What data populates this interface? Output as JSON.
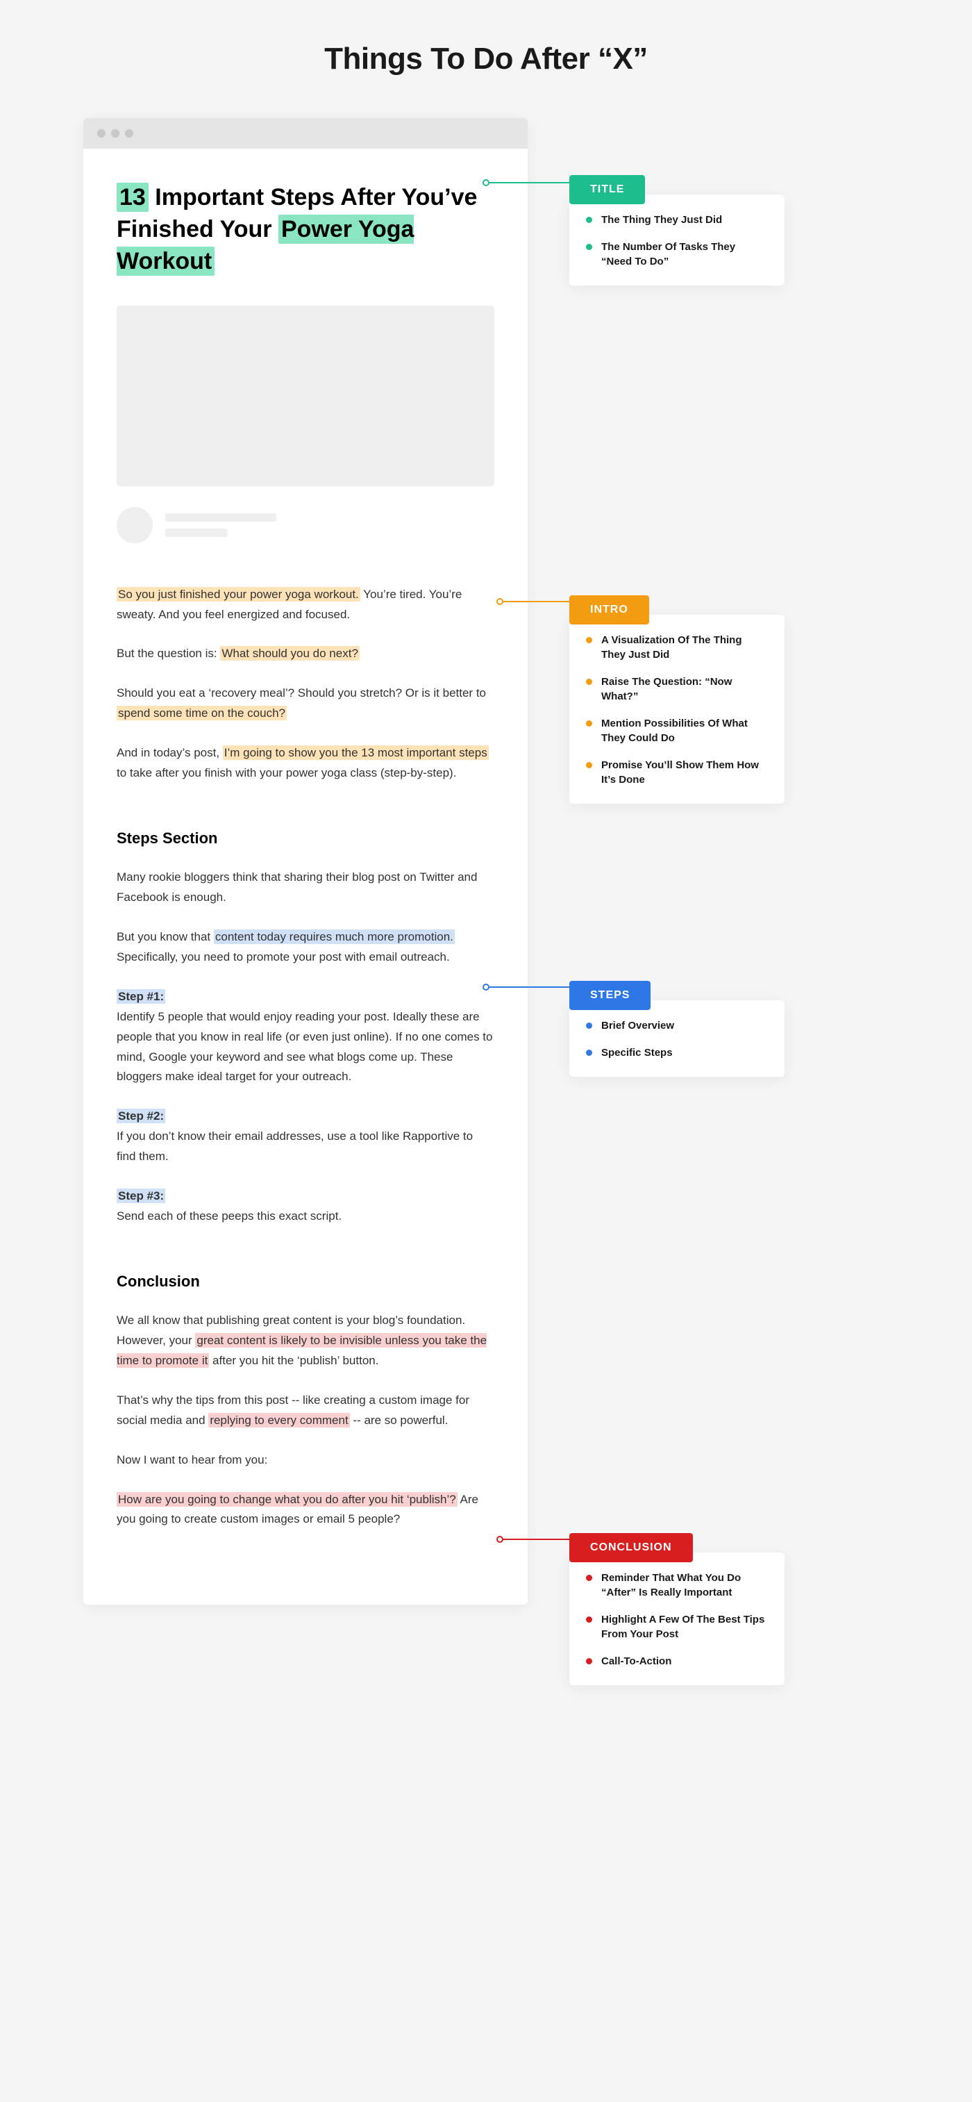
{
  "page_title": "Things To Do After “X”",
  "article": {
    "title_parts": {
      "num": "13",
      "mid": " Important Steps After You’ve Finished Your ",
      "topic": "Power Yoga Workout"
    },
    "intro": {
      "p1_hl": "So you just finished your power yoga workout.",
      "p1_rest": " You’re tired. You’re sweaty. And you feel energized and focused.",
      "p2_a": "But the question is: ",
      "p2_hl": "What should you do next?",
      "p3_a": "Should you eat a ‘recovery meal’? Should you stretch? Or is it better to ",
      "p3_hl": "spend some time on the couch?",
      "p4_a": "And in today’s post, ",
      "p4_hl": "I’m going to show you the 13 most important steps",
      "p4_b": " to take after you finish with your power yoga class (step-by-step)."
    },
    "steps": {
      "heading": "Steps Section",
      "p1": "Many rookie bloggers think that sharing their blog post on Twitter and Facebook is enough.",
      "p2_a": "But you know that ",
      "p2_hl": "content today requires much more promotion.",
      "p2_b": " Specifically, you need to promote your post with email outreach.",
      "s1_label": "Step #1:",
      "s1_body": "Identify 5 people that would enjoy reading your post. Ideally these are people that you know in real life (or even just online). If no one comes to mind, Google your keyword and see what blogs come up. These bloggers make ideal target for your outreach.",
      "s2_label": "Step #2:",
      "s2_body": "If you don’t know their email addresses, use a tool like Rapportive to find them.",
      "s3_label": "Step #3:",
      "s3_body": "Send each of these peeps this exact script."
    },
    "conclusion": {
      "heading": "Conclusion",
      "p1_a": "We all know that publishing great content is your blog’s foundation. However, your ",
      "p1_hl": "great content is likely to be invisible unless you take the time to promote it",
      "p1_b": " after you hit the ‘publish’ button.",
      "p2_a": "That’s why the tips from this post -- like creating a custom image for social media and ",
      "p2_hl": "replying to every comment",
      "p2_b": " -- are so powerful.",
      "p3": "Now I want to hear from you:",
      "p4_hl": "How are you going to change what you do after you hit ‘publish’?",
      "p4_b": " Are you going to create custom images or email 5 people?"
    }
  },
  "cards": {
    "title": {
      "label": "TITLE",
      "items": [
        "The Thing They Just Did",
        "The Number Of Tasks They “Need To Do”"
      ]
    },
    "intro": {
      "label": "INTRO",
      "items": [
        "A Visualization Of The Thing They Just Did",
        "Raise The Question: “Now What?”",
        "Mention Possibilities Of What They Could Do",
        "Promise You’ll Show Them How It’s Done"
      ]
    },
    "steps": {
      "label": "STEPS",
      "items": [
        "Brief Overview",
        "Specific Steps"
      ]
    },
    "conclusion": {
      "label": "CONCLUSION",
      "items": [
        "Reminder That What You Do “After” Is Really Important",
        "Highlight A Few Of The Best Tips From Your Post",
        "Call-To-Action"
      ]
    }
  }
}
